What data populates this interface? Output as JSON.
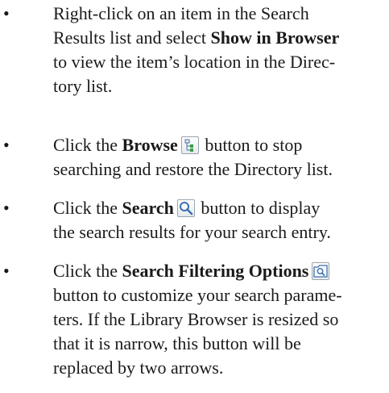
{
  "bullet_glyph": "•",
  "items": [
    {
      "lines": [
        {
          "text": "Right-click on an item in the Search"
        },
        {
          "pre": "Results list and select ",
          "bold": "Show in Browser",
          "post": ""
        },
        {
          "text": "to view the item’s location in the Direc-"
        },
        {
          "text": "tory list."
        }
      ]
    },
    {
      "line1_pre": "Click the ",
      "line1_bold": "Browse",
      "line1_post": " button to stop",
      "icon": "browse-tree-icon",
      "line2": "searching and restore the Directory list."
    },
    {
      "line1_pre": "Click the ",
      "line1_bold": "Search",
      "line1_post": " button to display",
      "icon": "search-magnifier-icon",
      "line2": "the search results for your search entry."
    },
    {
      "line1_pre": "Click the ",
      "line1_bold": "Search Filtering Options",
      "line1_post": "",
      "icon": "search-filter-icon",
      "lines": [
        "button to customize your search parame-",
        "ters. If the Library Browser is resized so",
        "that it is narrow, this button will be",
        "replaced by two arrows."
      ]
    }
  ]
}
